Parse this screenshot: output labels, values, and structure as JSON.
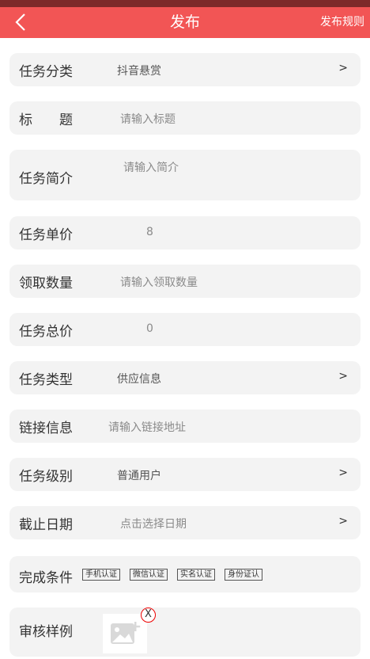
{
  "header": {
    "title": "发布",
    "rules": "发布规则"
  },
  "form": {
    "category": {
      "label": "任务分类",
      "value": "抖音悬赏",
      "arrow": ">"
    },
    "title": {
      "label": "标　　题",
      "placeholder": "请输入标题"
    },
    "intro": {
      "label": "任务简介",
      "placeholder": "请输入简介"
    },
    "unit_price": {
      "label": "任务单价",
      "value": "8"
    },
    "quantity": {
      "label": "领取数量",
      "placeholder": "请输入领取数量"
    },
    "total_price": {
      "label": "任务总价",
      "value": "0"
    },
    "type": {
      "label": "任务类型",
      "value": "供应信息",
      "arrow": ">"
    },
    "link": {
      "label": "链接信息",
      "placeholder": "请输入链接地址"
    },
    "level": {
      "label": "任务级别",
      "value": "普通用户",
      "arrow": ">"
    },
    "deadline": {
      "label": "截止日期",
      "placeholder": "点击选择日期",
      "arrow": ">"
    },
    "conditions": {
      "label": "完成条件",
      "options": [
        "手机认证",
        "微信认证",
        "实名认证",
        "身份证认"
      ]
    },
    "review": {
      "label": "审核样例",
      "close": "X"
    }
  },
  "colors": {
    "header": "#f25555",
    "statusbar": "#7d2a2a",
    "row_bg": "#f3f3f3"
  }
}
